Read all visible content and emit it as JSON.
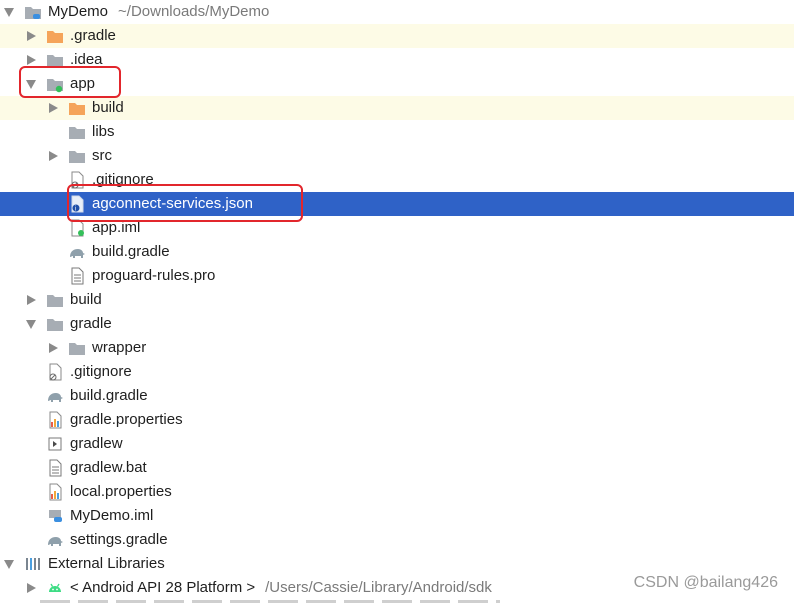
{
  "root": {
    "name": "MyDemo",
    "path": "~/Downloads/MyDemo"
  },
  "rows": {
    "gradle_dir": ".gradle",
    "idea_dir": ".idea",
    "app_dir": "app",
    "app_build": "build",
    "app_libs": "libs",
    "app_src": "src",
    "app_gitignore": ".gitignore",
    "app_agconnect": "agconnect-services.json",
    "app_iml": "app.iml",
    "app_build_gradle": "build.gradle",
    "app_proguard": "proguard-rules.pro",
    "build_dir": "build",
    "gradle_folder": "gradle",
    "gradle_wrapper": "wrapper",
    "root_gitignore": ".gitignore",
    "root_build_gradle": "build.gradle",
    "gradle_properties": "gradle.properties",
    "gradlew": "gradlew",
    "gradlew_bat": "gradlew.bat",
    "local_properties": "local.properties",
    "mydemo_iml": "MyDemo.iml",
    "settings_gradle": "settings.gradle"
  },
  "external": {
    "label": "External Libraries",
    "android_sdk": "< Android API 28 Platform >",
    "android_sdk_path": "/Users/Cassie/Library/Android/sdk"
  },
  "watermark": "CSDN @bailang426",
  "colors": {
    "selection": "#2f62c7",
    "excluded_bg": "#fdfbe6",
    "highlight_box": "#e2262c",
    "orange_folder": "#f5a45a",
    "gray_folder": "#a7adb4"
  }
}
